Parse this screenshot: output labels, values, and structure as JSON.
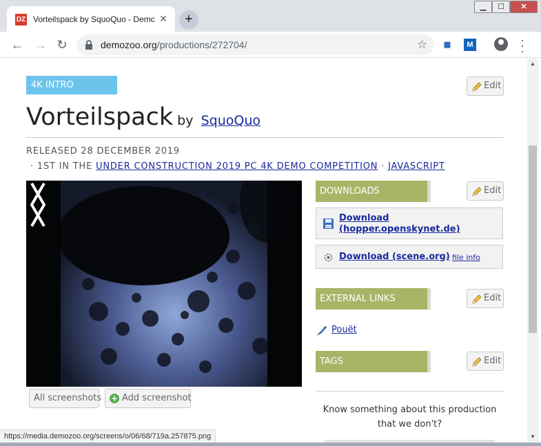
{
  "browser": {
    "tab_title": "Vorteilspack by SquoQuo - Demozoo",
    "favicon_text": "DZ",
    "new_tab_icon": "plus-icon",
    "url_domain": "demozoo.org",
    "url_path": "/productions/272704/",
    "extensions": [
      "extension-icon",
      "M"
    ],
    "status_url": "https://media.demozoo.org/screens/o/06/68/719a.257875.png"
  },
  "production": {
    "type_badge": "4K INTRO",
    "title": "Vorteilspack",
    "by_label": "by",
    "author": "SquoQuo",
    "released": "RELEASED 28 DECEMBER 2019",
    "meta_bullet": "·",
    "rank_prefix": "1ST IN THE",
    "competition": "UNDER CONSTRUCTION 2019 PC 4K DEMO COMPETITION",
    "platform": "JAVASCRIPT",
    "edit_label": "Edit"
  },
  "screenshots": {
    "all_label": "All screenshots",
    "add_label": "Add screenshot"
  },
  "downloads": {
    "heading": "DOWNLOADS",
    "edit_label": "Edit",
    "items": [
      {
        "label": "Download (hopper.openskynet.de)",
        "icon": "floppy-icon"
      },
      {
        "label": "Download (scene.org)",
        "icon": "scene-org-icon",
        "separator": "-",
        "extra": "file info"
      }
    ]
  },
  "external_links": {
    "heading": "EXTERNAL LINKS",
    "edit_label": "Edit",
    "items": [
      {
        "label": "Pouët",
        "icon": "pouet-icon"
      }
    ]
  },
  "tags": {
    "heading": "TAGS",
    "edit_label": "Edit"
  },
  "prompt": {
    "text": "Know something about this production that we don't?"
  },
  "colors": {
    "badge": "#6cc4ec",
    "panel_heading": "#a8b466",
    "link": "#1a2a9c"
  }
}
